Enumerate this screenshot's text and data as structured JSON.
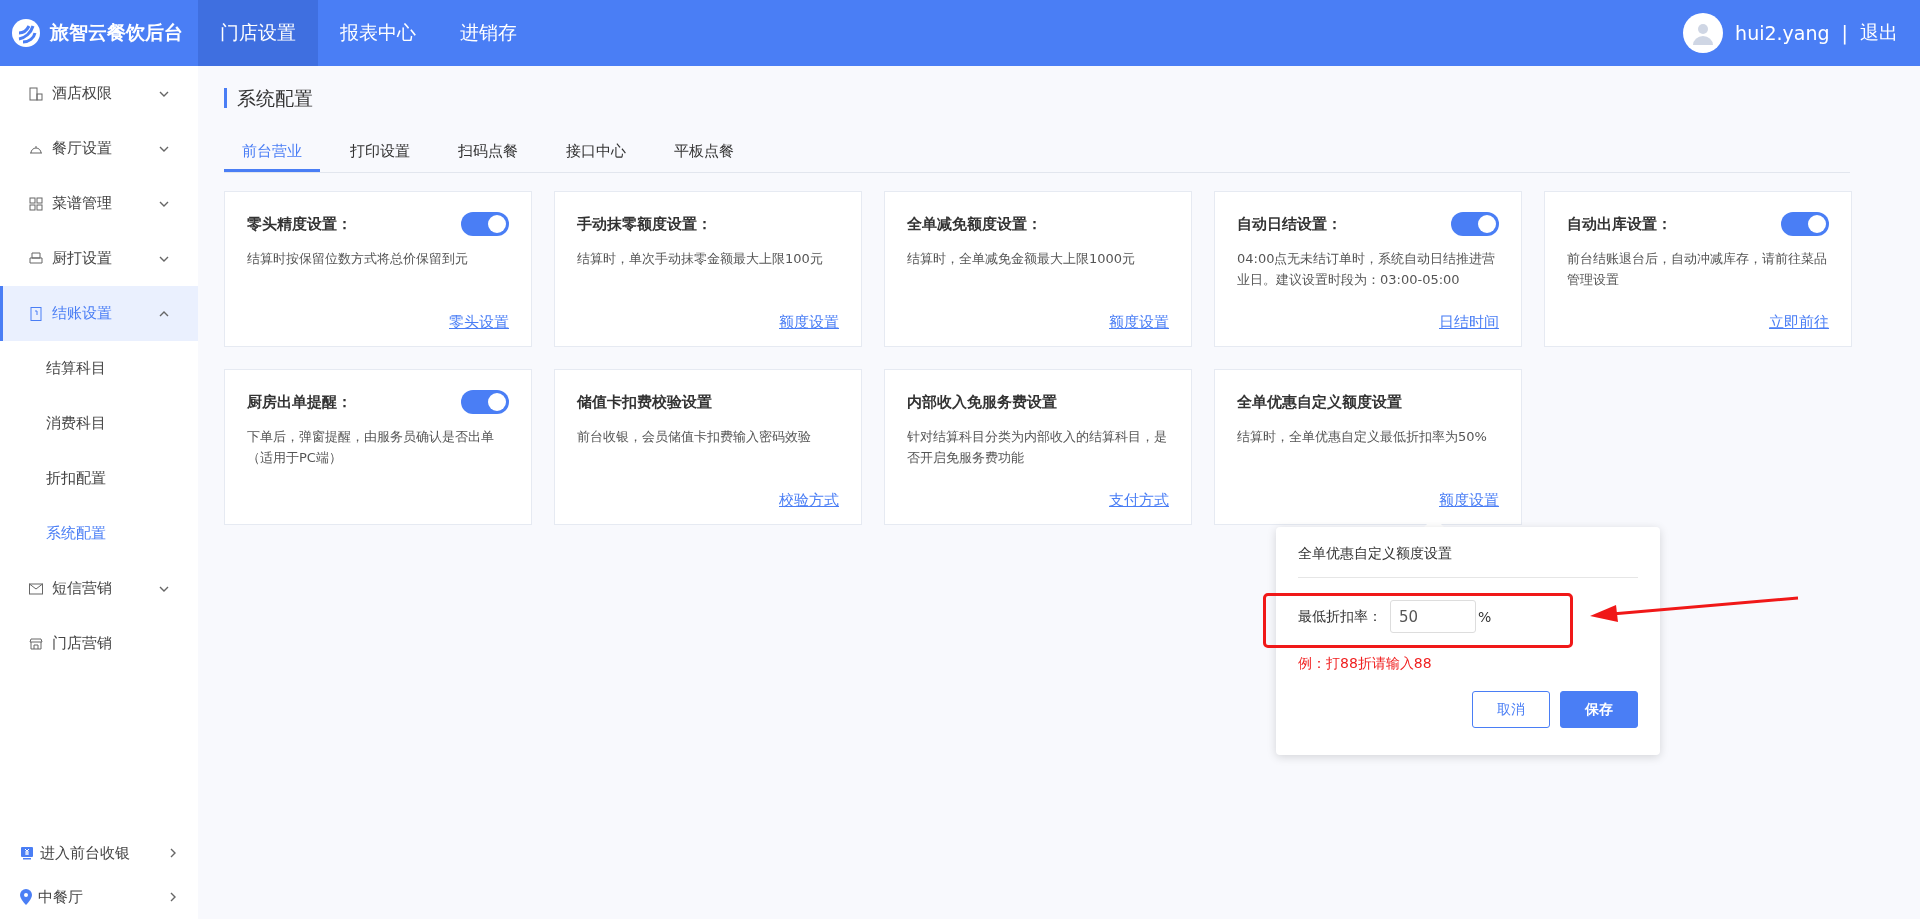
{
  "header": {
    "brand": "旅智云餐饮后台",
    "nav": [
      {
        "label": "门店设置",
        "selected": true
      },
      {
        "label": "报表中心",
        "selected": false
      },
      {
        "label": "进销存",
        "selected": false
      }
    ],
    "user": "hui2.yang",
    "separator": "|",
    "logout": "退出"
  },
  "sidebar": {
    "items": [
      {
        "label": "酒店权限",
        "kind": "group",
        "expanded": false,
        "selected": false
      },
      {
        "label": "餐厅设置",
        "kind": "group",
        "expanded": false,
        "selected": false
      },
      {
        "label": "菜谱管理",
        "kind": "group",
        "expanded": false,
        "selected": false
      },
      {
        "label": "厨打设置",
        "kind": "group",
        "expanded": false,
        "selected": false
      },
      {
        "label": "结账设置",
        "kind": "group",
        "expanded": true,
        "selected": true,
        "children": [
          {
            "label": "结算科目",
            "selected": false
          },
          {
            "label": "消费科目",
            "selected": false
          },
          {
            "label": "折扣配置",
            "selected": false
          },
          {
            "label": "系统配置",
            "selected": true
          }
        ]
      },
      {
        "label": "短信营销",
        "kind": "group",
        "expanded": false,
        "selected": false
      },
      {
        "label": "门店营销",
        "kind": "link",
        "selected": false
      }
    ],
    "footer": [
      {
        "label": "进入前台收银"
      },
      {
        "label": "中餐厅"
      }
    ]
  },
  "page": {
    "title": "系统配置",
    "tabs": [
      {
        "label": "前台营业",
        "selected": true
      },
      {
        "label": "打印设置",
        "selected": false
      },
      {
        "label": "扫码点餐",
        "selected": false
      },
      {
        "label": "接口中心",
        "selected": false
      },
      {
        "label": "平板点餐",
        "selected": false
      }
    ],
    "cards": [
      {
        "title": "零头精度设置：",
        "kind": "toggle",
        "on": true,
        "description": "结算时按保留位数方式将总价保留到元",
        "link": "零头设置"
      },
      {
        "title": "手动抹零额度设置：",
        "kind": "plain",
        "description": "结算时，单次手动抹零金额最大上限100元",
        "link": "额度设置"
      },
      {
        "title": "全单减免额度设置：",
        "kind": "plain",
        "description": "结算时，全单减免金额最大上限1000元",
        "link": "额度设置"
      },
      {
        "title": "自动日结设置：",
        "kind": "toggle",
        "on": true,
        "description": "04:00点无未结订单时，系统自动日结推进营业日。建议设置时段为：03:00-05:00",
        "link": "日结时间"
      },
      {
        "title": "自动出库设置：",
        "kind": "toggle",
        "on": true,
        "description": "前台结账退台后，自动冲减库存，请前往菜品管理设置",
        "link": "立即前往"
      },
      {
        "title": "厨房出单提醒：",
        "kind": "toggle",
        "on": true,
        "description": "下单后，弹窗提醒，由服务员确认是否出单（适用于PC端）"
      },
      {
        "title": "储值卡扣费校验设置",
        "kind": "plain",
        "description": "前台收银，会员储值卡扣费输入密码效验",
        "link": "校验方式"
      },
      {
        "title": "内部收入免服务费设置",
        "kind": "plain",
        "description": "针对结算科目分类为内部收入的结算科目，是否开启免服务费功能",
        "link": "支付方式"
      },
      {
        "title": "全单优惠自定义额度设置",
        "kind": "plain",
        "description": "结算时，全单优惠自定义最低折扣率为50%",
        "link": "额度设置"
      }
    ]
  },
  "popover": {
    "title": "全单优惠自定义额度设置",
    "label": "最低折扣率：",
    "value": "50",
    "unit": "%",
    "hint": "例：打88折请输入88",
    "buttons": [
      {
        "label": "取消",
        "kind": "secondary"
      },
      {
        "label": "保存",
        "kind": "primary"
      }
    ]
  }
}
